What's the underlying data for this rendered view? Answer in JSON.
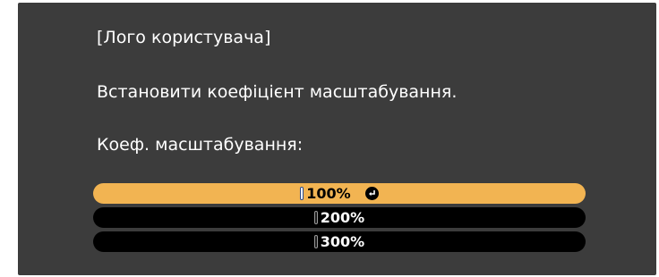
{
  "dialog": {
    "title": "[Лого користувача]",
    "message": "Встановити коефіцієнт масштабування.",
    "field_label": "Коеф. масштабування:"
  },
  "zoom_options": [
    {
      "label": "100%",
      "selected": true,
      "confirm_icon": "enter-icon"
    },
    {
      "label": "200%",
      "selected": false
    },
    {
      "label": "300%",
      "selected": false
    }
  ],
  "colors": {
    "background": "#3c3c3c",
    "highlight": "#f2b452",
    "option_bg": "#000000",
    "text": "#ffffff"
  }
}
